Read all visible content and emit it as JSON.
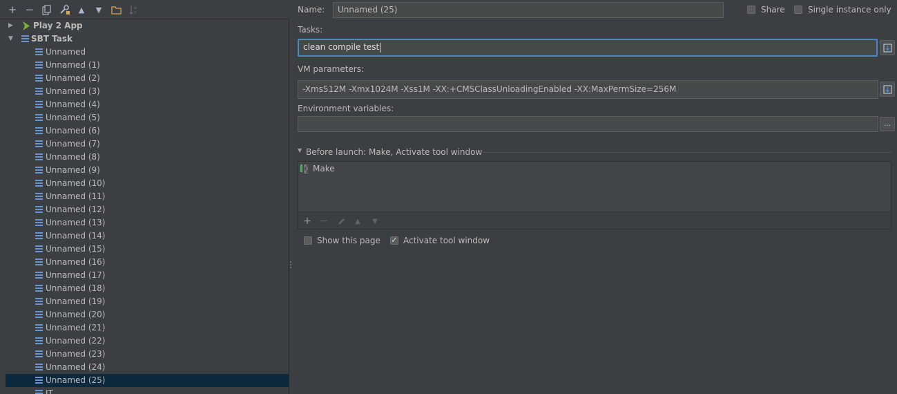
{
  "toolbar": {
    "icons": [
      "add-icon",
      "remove-icon",
      "copy-icon",
      "edit-defaults-icon",
      "move-up-icon",
      "move-down-icon",
      "folder-icon",
      "sort-icon"
    ]
  },
  "tree": {
    "play_app": "Play 2 App",
    "sbt_task": "SBT Task",
    "items": [
      "Unnamed",
      "Unnamed (1)",
      "Unnamed (2)",
      "Unnamed (3)",
      "Unnamed (4)",
      "Unnamed (5)",
      "Unnamed (6)",
      "Unnamed (7)",
      "Unnamed (8)",
      "Unnamed (9)",
      "Unnamed (10)",
      "Unnamed (11)",
      "Unnamed (12)",
      "Unnamed (13)",
      "Unnamed (14)",
      "Unnamed (15)",
      "Unnamed (16)",
      "Unnamed (17)",
      "Unnamed (18)",
      "Unnamed (19)",
      "Unnamed (20)",
      "Unnamed (21)",
      "Unnamed (22)",
      "Unnamed (23)",
      "Unnamed (24)",
      "Unnamed (25)",
      "IT"
    ],
    "selected_index": 25
  },
  "form": {
    "name_label": "Name:",
    "name_value": "Unnamed (25)",
    "share_label": "Share",
    "single_instance_label": "Single instance only",
    "tasks_label": "Tasks:",
    "tasks_value": "clean compile test",
    "vm_label": "VM parameters:",
    "vm_value": "-Xms512M -Xmx1024M -Xss1M -XX:+CMSClassUnloadingEnabled -XX:MaxPermSize=256M",
    "env_label": "Environment variables:",
    "env_value": "",
    "env_button": "...",
    "before_launch_label": "Before launch: Make, Activate tool window",
    "launch_items": [
      "Make"
    ],
    "show_page_label": "Show this page",
    "activate_label": "Activate tool window",
    "share_checked": false,
    "single_instance_checked": false,
    "show_page_checked": false,
    "activate_checked": true
  },
  "colors": {
    "background": "#3c3f41",
    "selection": "#0d293e",
    "accent": "#4a88c7",
    "tree_icon": "#6a97d3",
    "play_icon": "#7bb33a"
  }
}
